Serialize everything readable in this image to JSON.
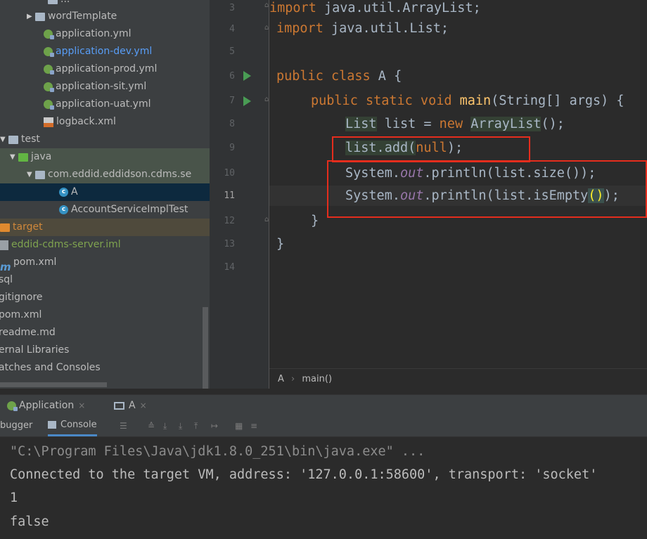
{
  "project_tree": [
    {
      "label": "wordTemplate",
      "icon": "folder-icon",
      "arrow": "▶",
      "indent": 2
    },
    {
      "label": "application.yml",
      "icon": "yml-file-icon",
      "indent": 3
    },
    {
      "label": "application-dev.yml",
      "icon": "yml-file-icon",
      "indent": 3,
      "color": "#589df6"
    },
    {
      "label": "application-prod.yml",
      "icon": "yml-file-icon",
      "indent": 3
    },
    {
      "label": "application-sit.yml",
      "icon": "yml-file-icon",
      "indent": 3
    },
    {
      "label": "application-uat.yml",
      "icon": "yml-file-icon",
      "indent": 3
    },
    {
      "label": "logback.xml",
      "icon": "xml-file-icon",
      "indent": 3
    },
    {
      "label": "test",
      "icon": "folder-icon",
      "arrow": "▼",
      "indent": 0
    },
    {
      "label": "java",
      "icon": "green-folder-icon",
      "arrow": "▼",
      "indent": 1,
      "bg": "test"
    },
    {
      "label": "com.eddid.eddidson.cdms.se",
      "icon": "package-icon",
      "arrow": "▼",
      "indent": 2,
      "bg": "test"
    },
    {
      "label": "A",
      "icon": "class-icon",
      "indent": 4,
      "selected": true
    },
    {
      "label": "AccountServiceImplTest",
      "icon": "class-icon",
      "indent": 4
    },
    {
      "label": "target",
      "icon": "orange-folder-icon",
      "indent": 0,
      "color": "#d0883b",
      "bg": "target"
    },
    {
      "label": "eddid-cdms-server.iml",
      "icon": "iml-file-icon",
      "indent": 0,
      "color": "#7fa34f"
    },
    {
      "label": "pom.xml",
      "icon": "maven-icon",
      "indent": 0
    },
    {
      "label": "sql",
      "indent": -1
    },
    {
      "label": "gitignore",
      "indent": -1
    },
    {
      "label": "pom.xml",
      "indent": -1
    },
    {
      "label": "readme.md",
      "indent": -1
    },
    {
      "label": "ernal Libraries",
      "indent": -1
    },
    {
      "label": "atches and Consoles",
      "indent": -1
    }
  ],
  "tree_top_partial": "...",
  "line_numbers": [
    "3",
    "4",
    "5",
    "6",
    "7",
    "8",
    "9",
    "10",
    "11",
    "12",
    "13",
    "14"
  ],
  "code": {
    "l3_kw": "import",
    "l3_rest": " java.util.ArrayList;",
    "l4_kw": "import",
    "l4_rest": " java.util.List;",
    "l6_kw": "public class",
    "l6_rest": " A {",
    "l7_kw": "public static void",
    "l7_fn": "main",
    "l7_rest": "(String[] args) {",
    "l8_t1": "List",
    "l8_t2": " list = ",
    "l8_kw": "new",
    "l8_t3": "ArrayList",
    "l8_t4": "();",
    "l9_t1": "list.add(",
    "l9_kw": "null",
    "l9_t2": ");",
    "l10_t1": "System.",
    "l10_it": "out",
    "l10_t2": ".println(list.size());",
    "l11_t1": "System.",
    "l11_it": "out",
    "l11_t2": ".println(list.isEmpty",
    "l11_brk": "()",
    "l11_t3": ");",
    "l12": "}",
    "l13": "}"
  },
  "breadcrumb": {
    "file": "A",
    "sep": "›",
    "method": "main()"
  },
  "run_tabs": [
    {
      "label": "Application",
      "icon": "spring-icon"
    },
    {
      "label": "A",
      "icon": "console-tab-icon"
    }
  ],
  "tab_close": "×",
  "sub_tabs": {
    "debugger": "bugger",
    "console": "Console"
  },
  "console_lines": [
    "\"C:\\Program Files\\Java\\jdk1.8.0_251\\bin\\java.exe\" ...",
    "Connected to the target VM, address: '127.0.0.1:58600', transport: 'socket'",
    "1",
    "false"
  ],
  "colors": {
    "accent": "#4a88c7",
    "highlight_box": "#e52d1d",
    "keyword": "#cc7832",
    "function": "#ffc66d",
    "field": "#9876aa"
  }
}
